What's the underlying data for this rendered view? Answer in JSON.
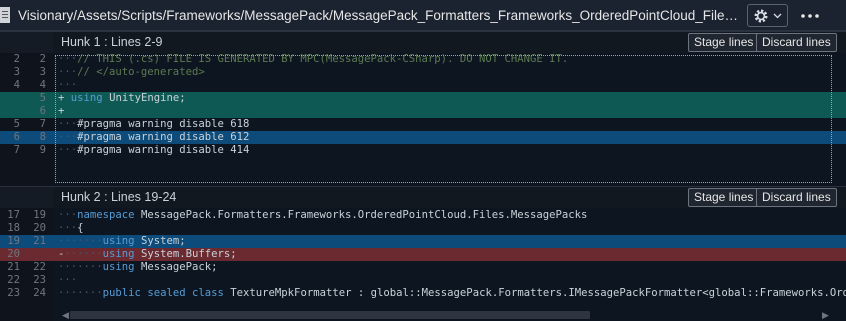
{
  "title_bar": {
    "file_path": "Visionary/Assets/Scripts/Frameworks/MessagePack/MessagePack_Formatters_Frameworks_OrderedPointCloud_Files_MessagePacks_Texture...",
    "settings_icon": "gear-icon",
    "dropdown_icon": "chevron-down-icon",
    "more_icon": "ellipsis-icon"
  },
  "buttons": {
    "stage_lines": "Stage lines",
    "discard_lines": "Discard lines"
  },
  "hunks": [
    {
      "title": "Hunk 1 : Lines 2-9",
      "lines": [
        {
          "old": "2",
          "new": "2",
          "text": "···// THIS (.cs) FILE IS GENERATED BY MPC(MessagePack-CSharp). DO NOT CHANGE IT.",
          "kind": "context-comment"
        },
        {
          "old": "3",
          "new": "3",
          "text": "···// </auto-generated>",
          "kind": "context-comment"
        },
        {
          "old": "4",
          "new": "4",
          "text": "···",
          "kind": "context"
        },
        {
          "old": "",
          "new": "5",
          "text": "+ using UnityEngine;",
          "kind": "add"
        },
        {
          "old": "",
          "new": "6",
          "text": "+",
          "kind": "add"
        },
        {
          "old": "5",
          "new": "7",
          "text": "···#pragma warning disable 618",
          "kind": "context"
        },
        {
          "old": "6",
          "new": "8",
          "text": "···#pragma warning disable 612",
          "kind": "selected"
        },
        {
          "old": "7",
          "new": "9",
          "text": "···#pragma warning disable 414",
          "kind": "context"
        }
      ]
    },
    {
      "title": "Hunk 2 : Lines 19-24",
      "lines": [
        {
          "old": "17",
          "new": "19",
          "text": "···namespace MessagePack.Formatters.Frameworks.OrderedPointCloud.Files.MessagePacks",
          "kind": "context"
        },
        {
          "old": "18",
          "new": "20",
          "text": "···{",
          "kind": "context"
        },
        {
          "old": "19",
          "new": "21",
          "text": "·······using System;",
          "kind": "selected"
        },
        {
          "old": "20",
          "new": "",
          "text": "-······using System.Buffers;",
          "kind": "delete"
        },
        {
          "old": "21",
          "new": "22",
          "text": "·······using MessagePack;",
          "kind": "context"
        },
        {
          "old": "22",
          "new": "23",
          "text": "···",
          "kind": "context"
        },
        {
          "old": "23",
          "new": "24",
          "text": "·······public sealed class TextureMpkFormatter : global::MessagePack.Formatters.IMessagePackFormatter<global::Frameworks.Ordered",
          "kind": "context"
        }
      ]
    }
  ]
}
